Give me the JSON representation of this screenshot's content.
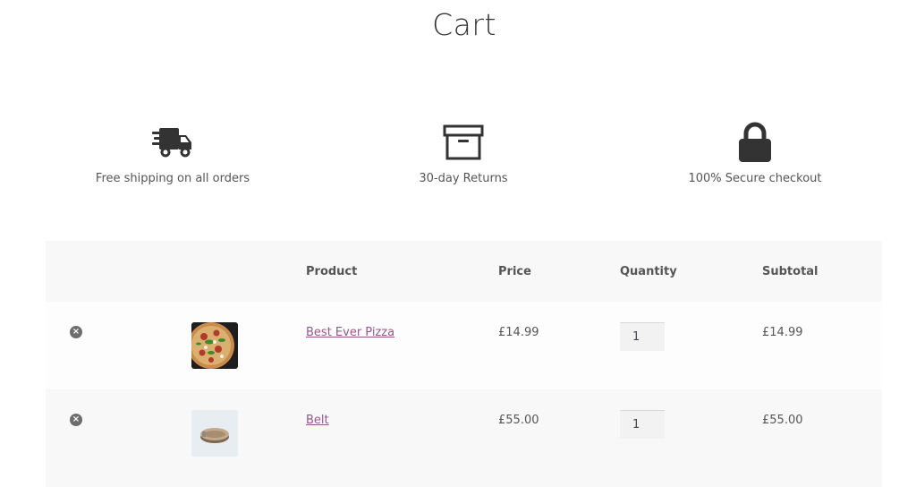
{
  "page": {
    "title": "Cart"
  },
  "features": [
    {
      "icon": "truck-icon",
      "label": "Free shipping on all orders"
    },
    {
      "icon": "archive-box-icon",
      "label": "30-day Returns"
    },
    {
      "icon": "lock-icon",
      "label": "100% Secure checkout"
    }
  ],
  "cart": {
    "headers": {
      "product": "Product",
      "price": "Price",
      "quantity": "Quantity",
      "subtotal": "Subtotal"
    },
    "items": [
      {
        "name": "Best Ever Pizza",
        "price": "£14.99",
        "quantity": "1",
        "subtotal": "£14.99",
        "thumbnail": "pizza-image"
      },
      {
        "name": "Belt",
        "price": "£55.00",
        "quantity": "1",
        "subtotal": "£55.00",
        "thumbnail": "belt-image"
      }
    ]
  },
  "colors": {
    "link": "#96588a",
    "text": "#43454b",
    "row_alt": "#f8f8f8"
  }
}
